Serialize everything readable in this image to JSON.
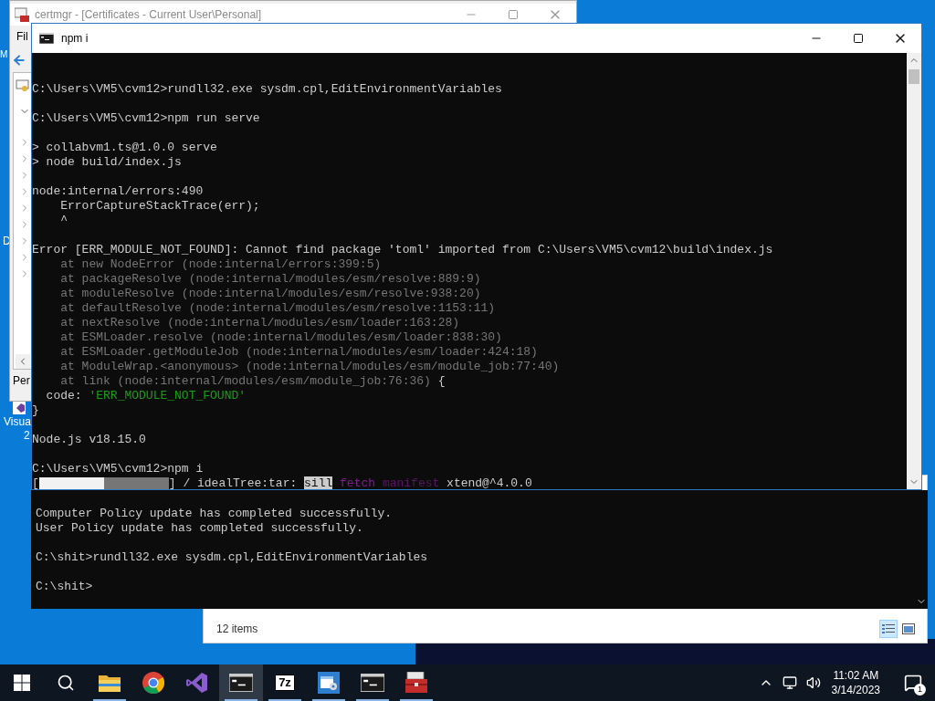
{
  "desktop": {
    "fragments": [
      "M",
      "D"
    ],
    "icon_label": [
      "Visua",
      "2"
    ]
  },
  "certmgr": {
    "title": "certmgr - [Certificates - Current User\\Personal]",
    "menu": [
      "Fil"
    ],
    "tree": [
      {
        "expanded": true
      },
      {
        "expanded": false
      },
      {
        "expanded": false
      },
      {
        "expanded": false
      },
      {
        "expanded": false
      },
      {
        "expanded": false
      },
      {
        "expanded": false
      },
      {
        "expanded": false
      },
      {
        "expanded": false
      },
      {
        "expanded": false
      }
    ],
    "status": "Per"
  },
  "explorer": {
    "status": "12 items",
    "views": [
      {
        "kind": "details",
        "selected": true
      },
      {
        "kind": "large-icons",
        "selected": false
      }
    ]
  },
  "console_back": {
    "blocks": [
      [
        [
          {
            "text": "Computer Policy update has completed successfully.",
            "kind": "normal"
          }
        ],
        [
          {
            "text": "User Policy update has completed successfully.",
            "kind": "normal"
          }
        ]
      ],
      [
        [
          {
            "text": "C:\\shit>rundll32.exe sysdm.cpl,EditEnvironmentVariables",
            "kind": "normal"
          }
        ]
      ],
      [
        [
          {
            "text": "C:\\shit>",
            "kind": "normal"
          }
        ]
      ]
    ]
  },
  "npm_window": {
    "title": "npm i",
    "blocks": [
      [
        [
          {
            "text": "C:\\Users\\VM5\\cvm12>rundll32.exe sysdm.cpl,EditEnvironmentVariables",
            "kind": "normal"
          }
        ]
      ],
      [
        [
          {
            "text": "C:\\Users\\VM5\\cvm12>npm run serve",
            "kind": "normal"
          }
        ]
      ],
      [
        [
          {
            "text": "> collabvm1.ts@1.0.0 serve",
            "kind": "normal"
          }
        ],
        [
          {
            "text": "> node build/index.js",
            "kind": "normal"
          }
        ]
      ],
      [
        [
          {
            "text": "node:internal/errors:490",
            "kind": "normal"
          }
        ],
        [
          {
            "text": "    ErrorCaptureStackTrace(err);",
            "kind": "normal"
          }
        ],
        [
          {
            "text": "    ^",
            "kind": "normal"
          }
        ]
      ],
      [
        [
          {
            "text": "Error [ERR_MODULE_NOT_FOUND]: Cannot find package 'toml' imported from C:\\Users\\VM5\\cvm12\\build\\index.js",
            "kind": "normal"
          }
        ],
        [
          {
            "text": "    at new NodeError (node:internal/errors:399:5)",
            "kind": "dim"
          }
        ],
        [
          {
            "text": "    at packageResolve (node:internal/modules/esm/resolve:889:9)",
            "kind": "dim"
          }
        ],
        [
          {
            "text": "    at moduleResolve (node:internal/modules/esm/resolve:938:20)",
            "kind": "dim"
          }
        ],
        [
          {
            "text": "    at defaultResolve (node:internal/modules/esm/resolve:1153:11)",
            "kind": "dim"
          }
        ],
        [
          {
            "text": "    at nextResolve (node:internal/modules/esm/loader:163:28)",
            "kind": "dim"
          }
        ],
        [
          {
            "text": "    at ESMLoader.resolve (node:internal/modules/esm/loader:838:30)",
            "kind": "dim"
          }
        ],
        [
          {
            "text": "    at ESMLoader.getModuleJob (node:internal/modules/esm/loader:424:18)",
            "kind": "dim"
          }
        ],
        [
          {
            "text": "    at ModuleWrap.<anonymous> (node:internal/modules/esm/module_job:77:40)",
            "kind": "dim"
          }
        ],
        [
          {
            "text": "    at link (node:internal/modules/esm/module_job:76:36)",
            "kind": "dim"
          },
          {
            "text": " {",
            "kind": "normal"
          }
        ],
        [
          {
            "text": "  code: ",
            "kind": "normal"
          },
          {
            "text": "'ERR_MODULE_NOT_FOUND'",
            "kind": "string"
          }
        ],
        [
          {
            "text": "}",
            "kind": "normal"
          }
        ]
      ],
      [
        [
          {
            "text": "Node.js v18.15.0",
            "kind": "normal"
          }
        ]
      ],
      [
        [
          {
            "text": "C:\\Users\\VM5\\cvm12>npm i",
            "kind": "normal"
          }
        ],
        [
          {
            "text": "[",
            "kind": "normal"
          },
          {
            "kind": "progress",
            "level": 0.5
          },
          {
            "text": "] / idealTree:tar: ",
            "kind": "normal"
          },
          {
            "text": "sill",
            "kind": "highlight"
          },
          {
            "text": " fetch",
            "kind": "magenta"
          },
          {
            "text": " manifest",
            "kind": "purple"
          },
          {
            "text": " xtend@^4.0.0",
            "kind": "normal"
          }
        ]
      ]
    ]
  },
  "taskbar": {
    "items": [
      {
        "kind": "start",
        "running": false,
        "selected": false
      },
      {
        "kind": "search",
        "running": false,
        "selected": false
      },
      {
        "kind": "folder",
        "running": true,
        "selected": false
      },
      {
        "kind": "chrome",
        "running": false,
        "selected": false
      },
      {
        "kind": "vs",
        "running": false,
        "selected": false
      },
      {
        "kind": "terminal",
        "running": true,
        "selected": true
      },
      {
        "kind": "archiver",
        "label": "7z",
        "running": true,
        "selected": false
      },
      {
        "kind": "mmc",
        "running": true,
        "selected": false
      },
      {
        "kind": "terminal",
        "running": true,
        "selected": false
      },
      {
        "kind": "toolbox",
        "running": true,
        "selected": false
      }
    ],
    "tray": {
      "time": "11:02 AM",
      "date": "3/14/2023",
      "notifications": "1"
    }
  }
}
